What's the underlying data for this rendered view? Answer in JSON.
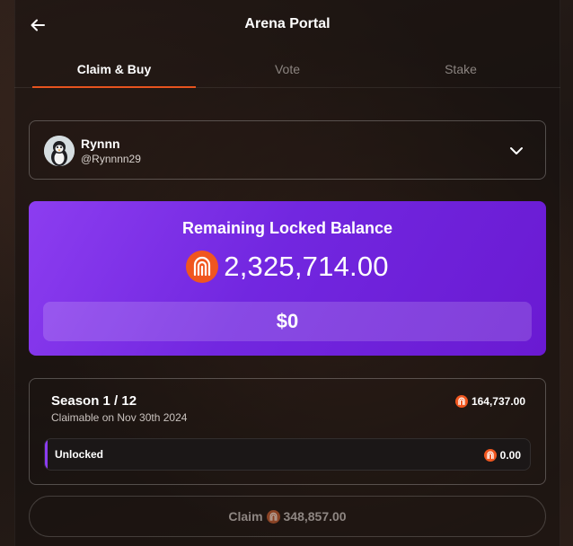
{
  "header": {
    "title": "Arena Portal",
    "back_icon": "arrow-left-icon"
  },
  "tabs": [
    {
      "label": "Claim & Buy",
      "active": true
    },
    {
      "label": "Vote",
      "active": false
    },
    {
      "label": "Stake",
      "active": false
    }
  ],
  "user": {
    "name": "Rynnn",
    "handle": "@Rynnnn29",
    "avatar_icon": "penguin-avatar",
    "dropdown_icon": "chevron-down-icon"
  },
  "balance": {
    "title": "Remaining Locked Balance",
    "amount": "2,325,714.00",
    "usd_value": "$0",
    "token_icon": "arena-token-icon"
  },
  "season": {
    "title": "Season 1 / 12",
    "subtitle": "Claimable on Nov 30th 2024",
    "amount": "164,737.00",
    "status_label": "Unlocked",
    "status_value": "0.00"
  },
  "claim": {
    "label": "Claim",
    "amount": "348,857.00"
  },
  "colors": {
    "accent": "#e7541f",
    "purple": "#7a2de6",
    "background": "#1c1614"
  }
}
